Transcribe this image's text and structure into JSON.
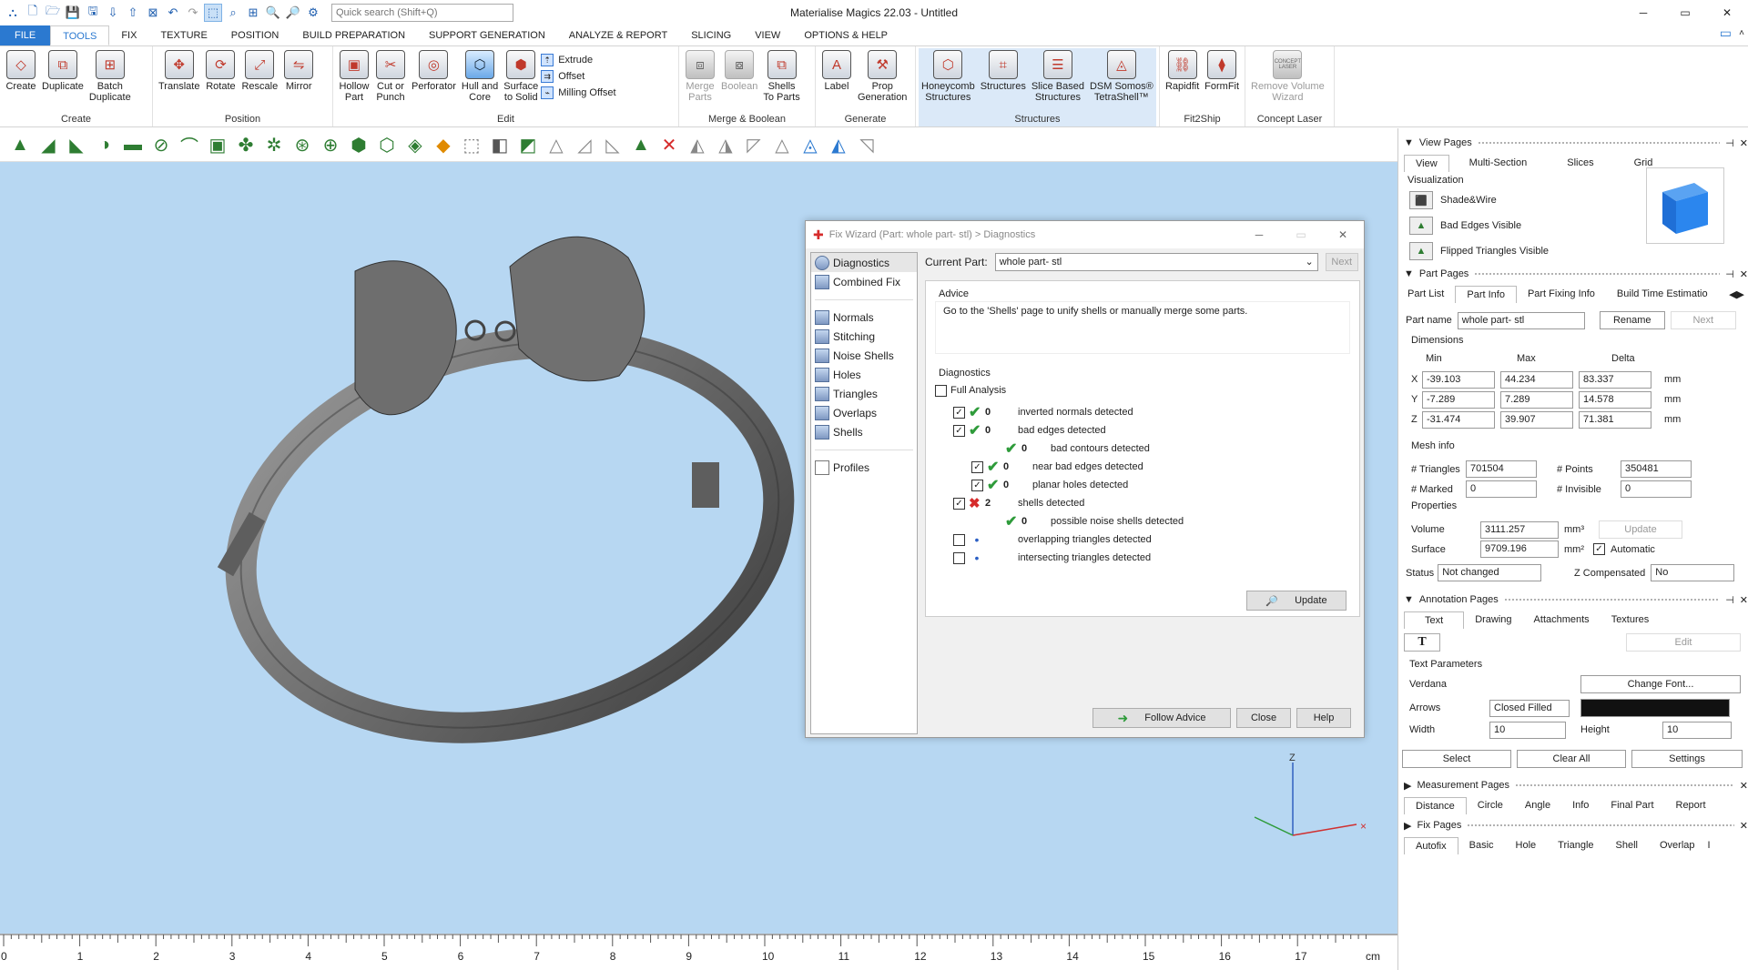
{
  "window": {
    "title": "Materialise Magics 22.03 - Untitled",
    "controls": [
      "─",
      "▭",
      "✕"
    ]
  },
  "search": {
    "placeholder": "Quick search (Shift+Q)"
  },
  "menu_tabs": [
    "FILE",
    "TOOLS",
    "FIX",
    "TEXTURE",
    "POSITION",
    "BUILD PREPARATION",
    "SUPPORT GENERATION",
    "ANALYZE & REPORT",
    "SLICING",
    "VIEW",
    "OPTIONS & HELP"
  ],
  "ribbon": {
    "create": {
      "label": "Create",
      "buttons": [
        "Create",
        "Duplicate",
        "Batch\nDuplicate"
      ]
    },
    "position": {
      "label": "Position",
      "buttons": [
        "Translate",
        "Rotate",
        "Rescale",
        "Mirror"
      ]
    },
    "edit": {
      "label": "Edit",
      "buttons": [
        "Hollow\nPart",
        "Cut or\nPunch",
        "Perforator",
        "Hull and\nCore",
        "Surface\nto Solid"
      ],
      "small": [
        "Extrude",
        "Offset",
        "Milling Offset"
      ]
    },
    "merge": {
      "label": "Merge & Boolean",
      "buttons": [
        "Merge\nParts",
        "Boolean",
        "Shells\nTo Parts"
      ]
    },
    "generate": {
      "label": "Generate",
      "buttons": [
        "Label",
        "Prop\nGeneration"
      ]
    },
    "structures": {
      "label": "Structures",
      "buttons": [
        "Honeycomb\nStructures",
        "Structures",
        "Slice Based\nStructures",
        "DSM Somos®\nTetraShell™"
      ]
    },
    "fit2ship": {
      "label": "Fit2Ship",
      "buttons": [
        "Rapidfit",
        "FormFit"
      ]
    },
    "concept": {
      "label": "Concept Laser",
      "buttons": [
        "Remove Volume\nWizard"
      ],
      "badge": "CONCEPT LASER"
    }
  },
  "ruler": {
    "unit": "cm",
    "ticks": [
      "0",
      "1",
      "2",
      "3",
      "4",
      "5",
      "6",
      "7",
      "8",
      "9",
      "10",
      "11",
      "12",
      "13",
      "14",
      "15",
      "16",
      "17"
    ]
  },
  "axes": {
    "z": "Z"
  },
  "dialog": {
    "title": "Fix Wizard (Part: whole part- stl) > Diagnostics",
    "nav": [
      "Diagnostics",
      "Combined Fix",
      "Normals",
      "Stitching",
      "Noise Shells",
      "Holes",
      "Triangles",
      "Overlaps",
      "Shells",
      "Profiles"
    ],
    "current_part_label": "Current Part:",
    "current_part": "whole part- stl",
    "next": "Next",
    "advice_label": "Advice",
    "advice": "Go to the 'Shells' page to unify shells or manually merge some parts.",
    "diagnostics_label": "Diagnostics",
    "full_analysis": "Full Analysis",
    "rows": [
      {
        "cb": "☑",
        "status": "ok",
        "count": "0",
        "text": "inverted normals detected",
        "indent": 0
      },
      {
        "cb": "☑",
        "status": "ok",
        "count": "0",
        "text": "bad edges detected",
        "indent": 0
      },
      {
        "cb": "",
        "status": "ok",
        "count": "0",
        "text": "bad contours detected",
        "indent": 2
      },
      {
        "cb": "☑",
        "status": "ok",
        "count": "0",
        "text": "near bad edges detected",
        "indent": 1
      },
      {
        "cb": "☑",
        "status": "ok",
        "count": "0",
        "text": "planar holes detected",
        "indent": 1
      },
      {
        "cb": "☑",
        "status": "err",
        "count": "2",
        "text": "shells detected",
        "indent": 0
      },
      {
        "cb": "",
        "status": "ok",
        "count": "0",
        "text": "possible noise shells detected",
        "indent": 2
      },
      {
        "cb": "☐",
        "status": "dot",
        "count": "",
        "text": "overlapping triangles detected",
        "indent": 0
      },
      {
        "cb": "☐",
        "status": "dot",
        "count": "",
        "text": "intersecting triangles detected",
        "indent": 0
      }
    ],
    "update": "Update",
    "follow": "Follow Advice",
    "close": "Close",
    "help": "Help"
  },
  "panel": {
    "view_pages": "View Pages",
    "view_tabs": [
      "View",
      "Multi-Section",
      "Slices",
      "Grid"
    ],
    "visualization": "Visualization",
    "vis_items": [
      "Shade&Wire",
      "Bad Edges Visible",
      "Flipped Triangles Visible"
    ],
    "part_pages": "Part Pages",
    "part_tabs": [
      "Part List",
      "Part Info",
      "Part Fixing Info",
      "Build Time Estimatio"
    ],
    "part_name_label": "Part name",
    "part_name": "whole part- stl",
    "rename": "Rename",
    "next": "Next",
    "dimensions": "Dimensions",
    "dim_heads": [
      "Min",
      "Max",
      "Delta"
    ],
    "dims": [
      {
        "axis": "X",
        "min": "-39.103",
        "max": "44.234",
        "delta": "83.337",
        "unit": "mm"
      },
      {
        "axis": "Y",
        "min": "-7.289",
        "max": "7.289",
        "delta": "14.578",
        "unit": "mm"
      },
      {
        "axis": "Z",
        "min": "-31.474",
        "max": "39.907",
        "delta": "71.381",
        "unit": "mm"
      }
    ],
    "mesh_info": "Mesh info",
    "triangles_label": "# Triangles",
    "triangles": "701504",
    "points_label": "# Points",
    "points": "350481",
    "marked_label": "# Marked",
    "marked": "0",
    "invisible_label": "# Invisible",
    "invisible": "0",
    "properties": "Properties",
    "volume_label": "Volume",
    "volume": "3111.257",
    "volume_unit": "mm³",
    "update": "Update",
    "surface_label": "Surface",
    "surface": "9709.196",
    "surface_unit": "mm²",
    "automatic": "Automatic",
    "status_label": "Status",
    "status": "Not changed",
    "zcomp_label": "Z Compensated",
    "zcomp": "No",
    "annotation_pages": "Annotation Pages",
    "ann_tabs": [
      "Text",
      "Drawing",
      "Attachments",
      "Textures"
    ],
    "text_tool": "T",
    "edit": "Edit",
    "text_params": "Text Parameters",
    "font": "Verdana",
    "change_font": "Change Font...",
    "arrows_label": "Arrows",
    "arrows": "Closed Filled",
    "width_label": "Width",
    "width": "10",
    "height_label": "Height",
    "height": "10",
    "select": "Select",
    "clear_all": "Clear All",
    "settings": "Settings",
    "measurement_pages": "Measurement Pages",
    "meas_tabs": [
      "Distance",
      "Circle",
      "Angle",
      "Info",
      "Final Part",
      "Report"
    ],
    "fix_pages": "Fix Pages",
    "fix_tabs": [
      "Autofix",
      "Basic",
      "Hole",
      "Triangle",
      "Shell",
      "Overlap",
      "I"
    ]
  },
  "colors": {
    "accent": "#2b79d0",
    "viewport": "#b7d7f2",
    "ok": "#2e9b3a",
    "err": "#d62b2b",
    "dot": "#2b5fc4"
  }
}
